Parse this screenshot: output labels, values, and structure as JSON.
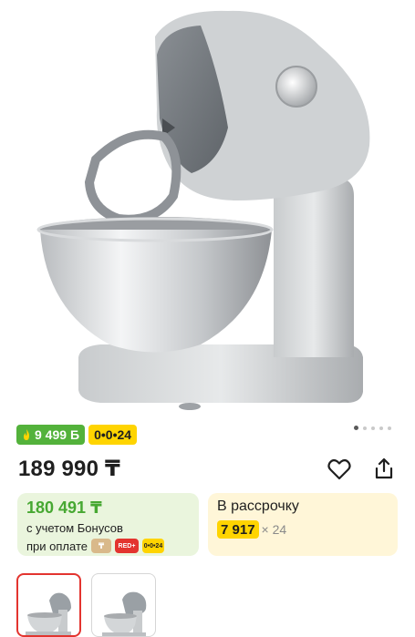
{
  "badges": {
    "bonus_amount": "9 499",
    "bonus_currency": "Б",
    "installment_label": "0•0•24"
  },
  "price": "189 990 ₸",
  "gallery": {
    "slide_count": 5,
    "active_slide": 1
  },
  "bonus_card": {
    "price": "180 491 ₸",
    "line1": "с учетом Бонусов",
    "line2": "при оплате",
    "icons": [
      "kaspi-icon",
      "RED+",
      "0•0•24"
    ]
  },
  "installment_card": {
    "title": "В рассрочку",
    "amount": "7 917",
    "multiplier": "× 24"
  },
  "thumbnails": [
    {
      "name": "mixer-front",
      "active": true
    },
    {
      "name": "mixer-side",
      "active": false
    }
  ],
  "colors": {
    "bonus_green": "#53b23b",
    "accent_yellow": "#ffd400",
    "active_thumb_border": "#e3342f"
  }
}
